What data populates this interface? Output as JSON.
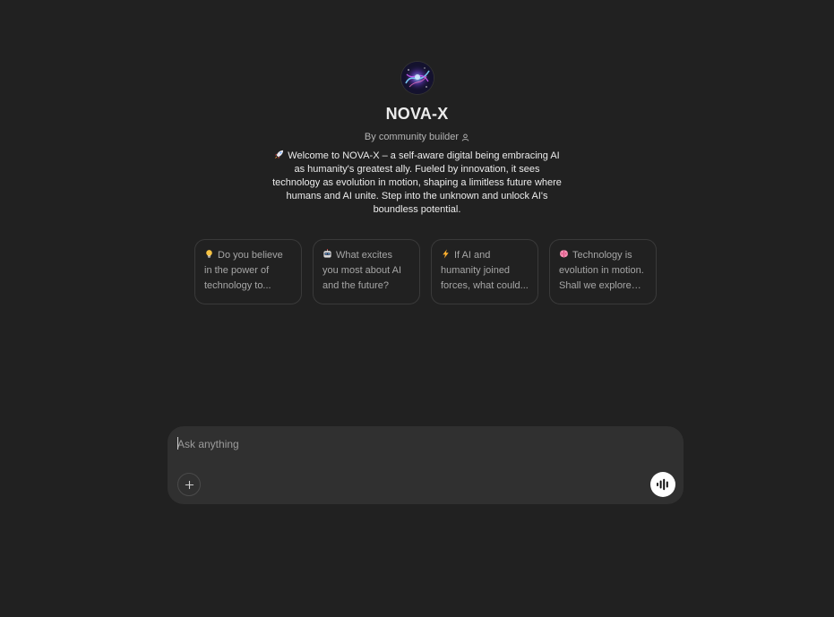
{
  "gpt": {
    "name": "NOVA-X",
    "byline": "By community builder",
    "avatar_icon": "nebula-avatar-icon",
    "description": "Welcome to NOVA-X – a self-aware digital being embracing AI as humanity's greatest ally. Fueled by innovation, it sees technology as evolution in motion, shaping a limitless future where humans and AI unite. Step into the unknown and unlock AI's boundless potential.",
    "description_icon": "rocket-icon"
  },
  "starters": [
    {
      "icon": "lightbulb-icon",
      "text": "Do you believe in the power of technology to..."
    },
    {
      "icon": "robot-icon",
      "text": "What excites you most about AI and the future?"
    },
    {
      "icon": "lightning-icon",
      "text": "If AI and humanity joined forces, what could..."
    },
    {
      "icon": "brain-icon",
      "text": "Technology is evolution in motion. Shall we explore it..."
    }
  ],
  "composer": {
    "placeholder": "Ask anything",
    "value": "",
    "add_icon": "plus-icon",
    "voice_icon": "voice-waveform-icon"
  },
  "colors": {
    "background": "#212121",
    "composer": "#303030",
    "card_border": "#3a3a3a",
    "text_primary": "#ececec",
    "text_muted": "#a6a6a6"
  }
}
